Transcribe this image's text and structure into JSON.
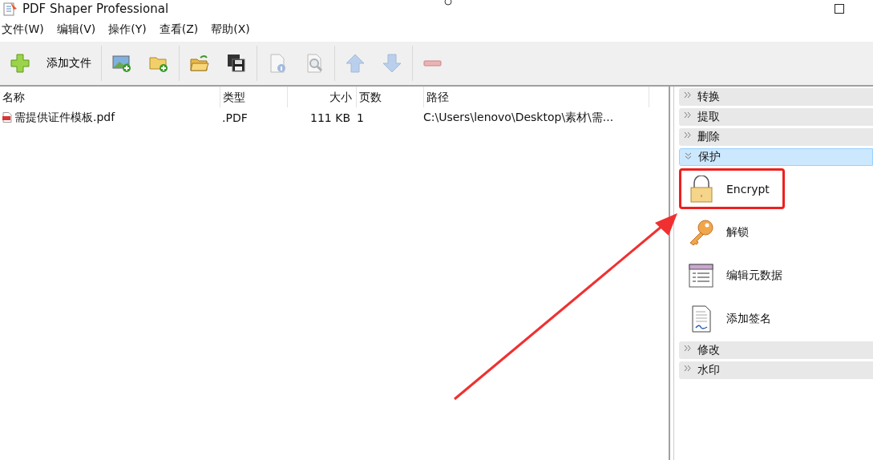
{
  "window": {
    "title": "PDF Shaper Professional"
  },
  "menu": [
    "文件(W)",
    "编辑(V)",
    "操作(Y)",
    "查看(Z)",
    "帮助(X)"
  ],
  "toolbar": [
    {
      "kind": "add",
      "label": "添加文件",
      "disabled": false
    },
    {
      "kind": "add-image",
      "disabled": false
    },
    {
      "kind": "add-folder",
      "disabled": false
    },
    {
      "kind": "open",
      "disabled": false
    },
    {
      "kind": "save",
      "disabled": false
    },
    {
      "kind": "info",
      "disabled": true
    },
    {
      "kind": "preview",
      "disabled": true
    },
    {
      "kind": "up",
      "disabled": true
    },
    {
      "kind": "down",
      "disabled": true
    },
    {
      "kind": "remove",
      "disabled": true
    }
  ],
  "table": {
    "columns": [
      "名称",
      "类型",
      "大小",
      "页数",
      "路径"
    ],
    "rows": [
      {
        "name": "需提供证件模板.pdf",
        "type": ".PDF",
        "size": "111 KB",
        "pages": "1",
        "path": "C:\\Users\\lenovo\\Desktop\\素材\\需..."
      }
    ]
  },
  "panel": {
    "sections": [
      {
        "label": "转换",
        "expanded": false
      },
      {
        "label": "提取",
        "expanded": false
      },
      {
        "label": "删除",
        "expanded": false
      },
      {
        "label": "保护",
        "expanded": true,
        "items": [
          {
            "kind": "lock",
            "label": "Encrypt",
            "highlighted": true
          },
          {
            "kind": "key",
            "label": "解锁",
            "highlighted": false
          },
          {
            "kind": "metadata",
            "label": "编辑元数据",
            "highlighted": false
          },
          {
            "kind": "signature",
            "label": "添加签名",
            "highlighted": false
          }
        ]
      },
      {
        "label": "修改",
        "expanded": false
      },
      {
        "label": "水印",
        "expanded": false
      }
    ]
  }
}
